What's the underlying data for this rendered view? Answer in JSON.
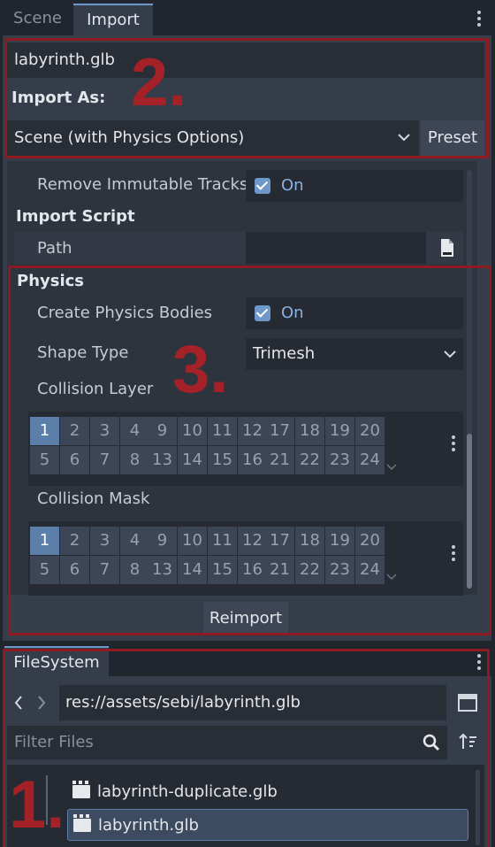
{
  "top_tabs": {
    "scene": "Scene",
    "import": "Import"
  },
  "import_panel": {
    "file_name": "labyrinth.glb",
    "import_as_label": "Import As:",
    "import_as_value": "Scene (with Physics Options)",
    "preset_label": "Preset"
  },
  "inspector": {
    "remove_immutable_tracks": {
      "label": "Remove Immutable Tracks",
      "value": "On"
    },
    "import_script_section": "Import Script",
    "path_label": "Path",
    "physics_section": "Physics",
    "create_physics_bodies": {
      "label": "Create Physics Bodies",
      "value": "On"
    },
    "shape_type": {
      "label": "Shape Type",
      "value": "Trimesh"
    },
    "collision_layer_label": "Collision Layer",
    "collision_mask_label": "Collision Mask",
    "collision_layer_active": 1,
    "collision_mask_active": 1
  },
  "reimport_label": "Reimport",
  "filesystem": {
    "tab_label": "FileSystem",
    "path": "res://assets/sebi/labyrinth.glb",
    "filter_placeholder": "Filter Files",
    "files": [
      "labyrinth-duplicate.glb",
      "labyrinth.glb"
    ],
    "selected_file": "labyrinth.glb"
  },
  "annotations": {
    "one": "1.",
    "two": "2.",
    "three": "3."
  },
  "icons": {
    "tab_menu": "kebab-menu-icon",
    "file_browse": "file-icon",
    "layers_menu": "kebab-menu-icon",
    "back": "chevron-left-icon",
    "forward": "chevron-right-icon",
    "split": "split-view-icon",
    "search": "search-icon",
    "sort": "sort-icon",
    "scene_file": "clapperboard-icon"
  },
  "colors": {
    "accent": "#6e98c9",
    "annotation": "#a52128",
    "panel": "#363d4a"
  }
}
